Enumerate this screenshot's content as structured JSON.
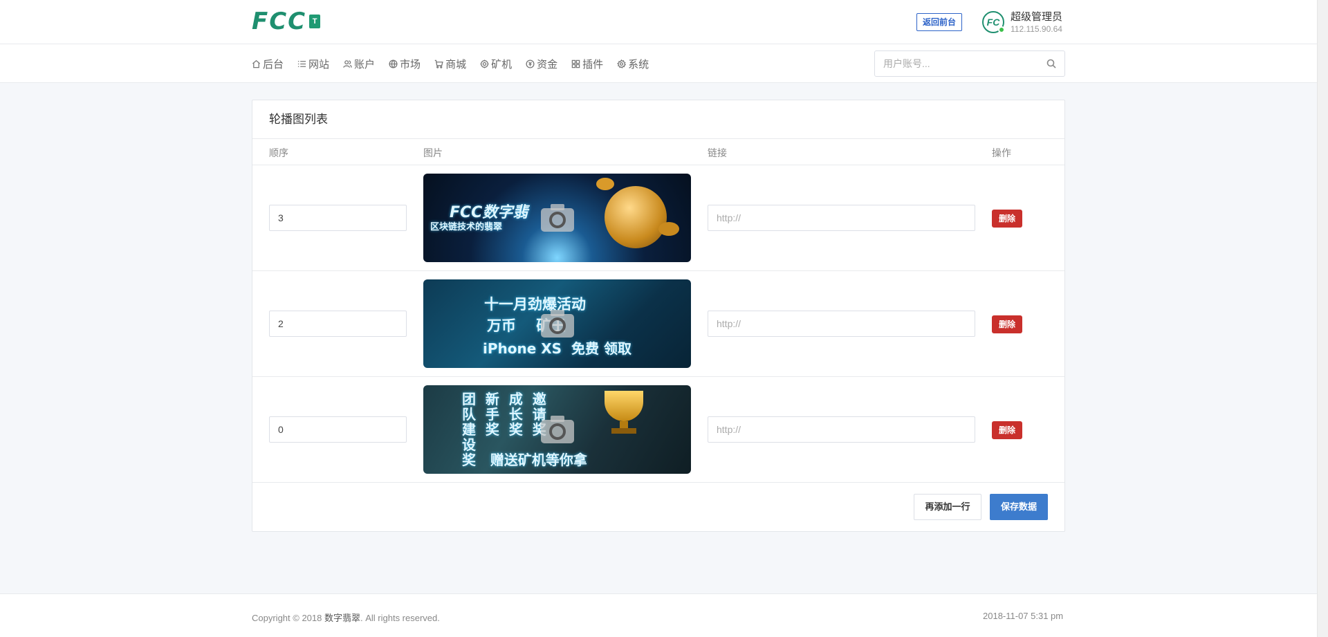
{
  "header": {
    "logo_text": "FCC",
    "logo_mark": "T",
    "back_label": "返回前台",
    "avatar_text": "FC",
    "user_name": "超级管理员",
    "user_ip": "112.115.90.64"
  },
  "nav": {
    "items": [
      {
        "label": "后台",
        "icon": "home-icon"
      },
      {
        "label": "网站",
        "icon": "list-icon"
      },
      {
        "label": "账户",
        "icon": "users-icon"
      },
      {
        "label": "市场",
        "icon": "globe-icon"
      },
      {
        "label": "商城",
        "icon": "cart-icon"
      },
      {
        "label": "矿机",
        "icon": "gear-icon"
      },
      {
        "label": "资金",
        "icon": "coin-icon"
      },
      {
        "label": "插件",
        "icon": "grid-icon"
      },
      {
        "label": "系统",
        "icon": "settings-icon"
      }
    ],
    "search_placeholder": "用户账号..."
  },
  "card": {
    "title": "轮播图列表",
    "columns": [
      "顺序",
      "图片",
      "链接",
      "操作"
    ],
    "rows": [
      {
        "order": "3",
        "link_placeholder": "http://",
        "delete_label": "删除",
        "banner": {
          "lines": [
            "FCC数字翡",
            "区块链技术的翡翠"
          ]
        }
      },
      {
        "order": "2",
        "link_placeholder": "http://",
        "delete_label": "删除",
        "banner": {
          "lines": [
            "十一月劲爆活动",
            "万币    矿王",
            "iPhone XS  免费 领取"
          ]
        }
      },
      {
        "order": "0",
        "link_placeholder": "http://",
        "delete_label": "删除",
        "banner": {
          "lines": [
            "团  新  成  邀",
            "队  手  长  请",
            "建  奖  奖  奖",
            "设",
            "奖   赠送矿机等你拿"
          ]
        }
      }
    ],
    "add_row_label": "再添加一行",
    "save_label": "保存数据"
  },
  "footer": {
    "copyright_prefix": "Copyright © 2018 ",
    "brand": "数字翡翠",
    "copyright_suffix": ". All rights reserved.",
    "datetime": "2018-11-07 5:31 pm"
  }
}
